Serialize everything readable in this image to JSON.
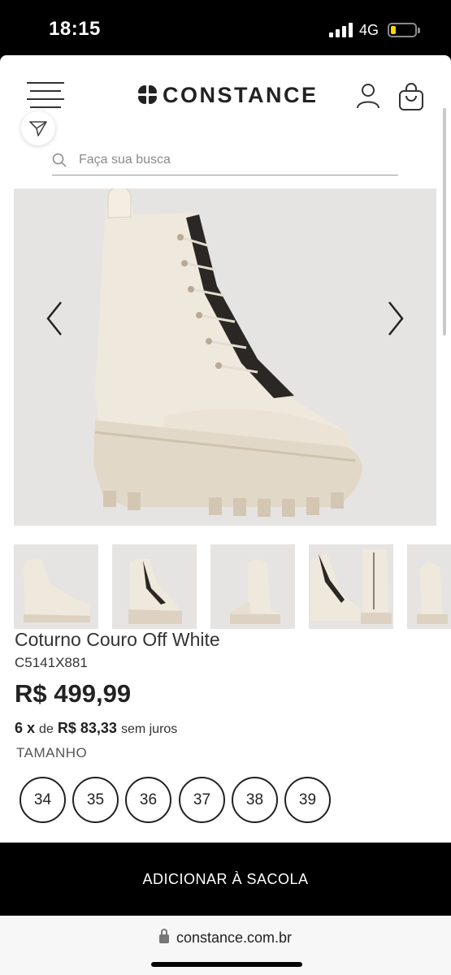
{
  "status_bar": {
    "time": "18:15",
    "network": "4G",
    "battery_level": 0.2,
    "battery_color": "#ffd60a"
  },
  "header": {
    "brand": "CONSTANCE",
    "icons": [
      "menu-icon",
      "user-icon",
      "shopping-bag-icon",
      "share-icon"
    ]
  },
  "search": {
    "placeholder": "Faça sua busca",
    "value": ""
  },
  "gallery": {
    "thumbnail_count": 5
  },
  "product": {
    "name": "Coturno Couro Off White",
    "code": "C5141X881",
    "price": "R$ 499,99",
    "installments": {
      "count": "6 x",
      "de": "de",
      "amount": "R$ 83,33",
      "suffix": "sem juros"
    },
    "size_label": "TAMANHO",
    "sizes": [
      "34",
      "35",
      "36",
      "37",
      "38",
      "39"
    ]
  },
  "cta": {
    "add_to_bag": "ADICIONAR À SACOLA"
  },
  "browser": {
    "url": "constance.com.br"
  },
  "colors": {
    "boot": "#efe7da",
    "boot_shade": "#ddd3c3",
    "image_bg": "#e6e4e2",
    "cta_bg": "#000000"
  }
}
